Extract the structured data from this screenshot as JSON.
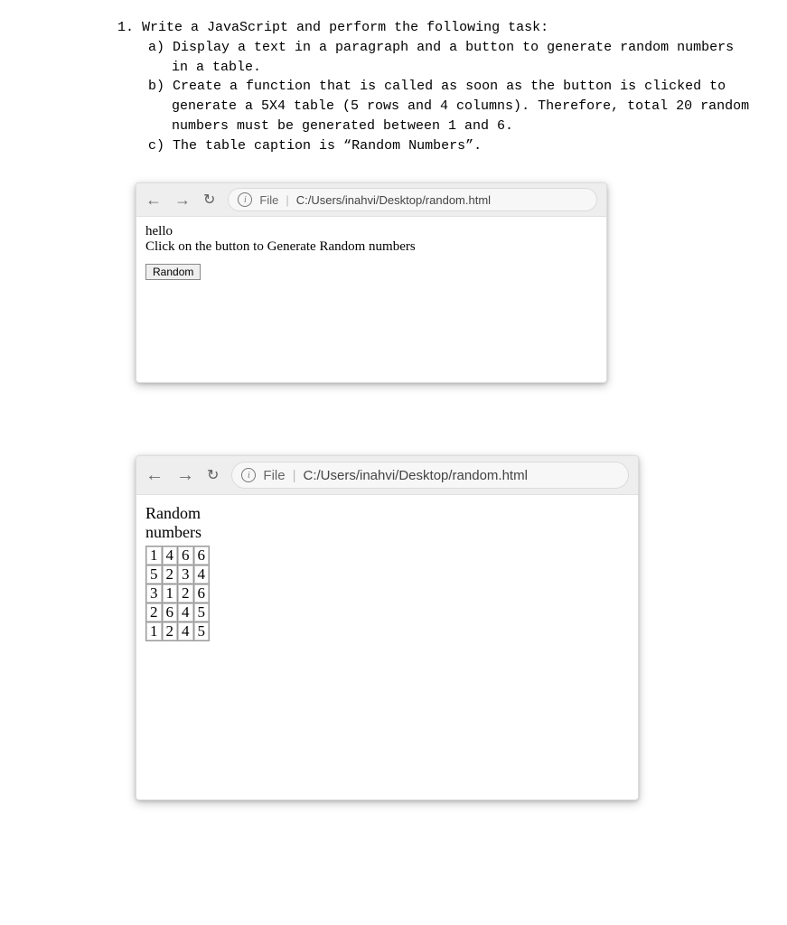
{
  "question": {
    "number": "1.",
    "stem": "Write a JavaScript and perform the following task:",
    "items": [
      {
        "letter": "a)",
        "text": "Display a text in a paragraph and a button to generate random numbers in a table."
      },
      {
        "letter": "b)",
        "text": "Create a function that is called as soon as the button is clicked to generate a 5X4 table (5 rows and 4 columns). Therefore, total 20 random numbers must be generated between 1 and 6."
      },
      {
        "letter": "c)",
        "text": "The table caption is “Random Numbers”."
      }
    ]
  },
  "screenshot1": {
    "url_label": "File",
    "url_path": "C:/Users/inahvi/Desktop/random.html",
    "greeting": "hello",
    "instruction": "Click on the button to Generate Random numbers",
    "button_label": "Random"
  },
  "screenshot2": {
    "url_label": "File",
    "url_path": "C:/Users/inahvi/Desktop/random.html",
    "caption_line1": "Random",
    "caption_line2": "numbers",
    "table": [
      [
        1,
        4,
        6,
        6
      ],
      [
        5,
        2,
        3,
        4
      ],
      [
        3,
        1,
        2,
        6
      ],
      [
        2,
        6,
        4,
        5
      ],
      [
        1,
        2,
        4,
        5
      ]
    ]
  },
  "chart_data": {
    "type": "table",
    "title": "Random numbers",
    "rows": 5,
    "cols": 4,
    "values": [
      [
        1,
        4,
        6,
        6
      ],
      [
        5,
        2,
        3,
        4
      ],
      [
        3,
        1,
        2,
        6
      ],
      [
        2,
        6,
        4,
        5
      ],
      [
        1,
        2,
        4,
        5
      ]
    ],
    "range": [
      1,
      6
    ]
  }
}
